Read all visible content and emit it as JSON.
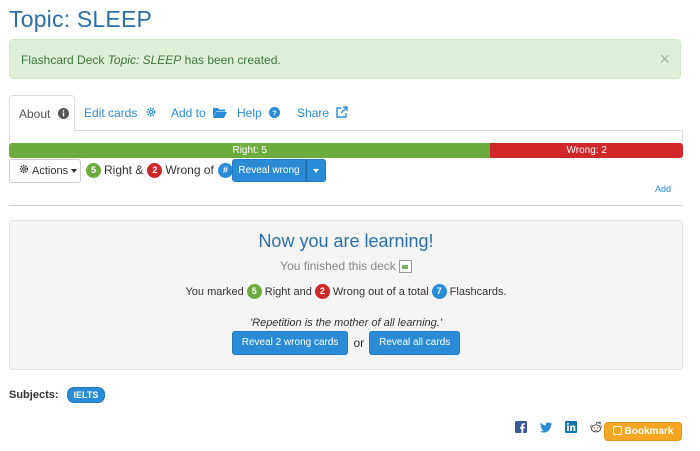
{
  "page": {
    "title": "Topic: SLEEP"
  },
  "alert": {
    "prefix": "Flashcard Deck ",
    "deck_name": "Topic: SLEEP",
    "suffix": " has been created.",
    "close_glyph": "×"
  },
  "tabs": [
    {
      "label": "About",
      "icon": "info-circle-icon"
    },
    {
      "label": "Edit cards",
      "icon": "cog-icon"
    },
    {
      "label": "Add to",
      "icon": "folder-open-icon"
    },
    {
      "label": "Help",
      "icon": "question-circle-icon"
    },
    {
      "label": "Share",
      "icon": "external-link-icon"
    }
  ],
  "progress": {
    "right_label": "Right: 5",
    "wrong_label": "Wrong: 2",
    "right_fraction": 0.7143,
    "colors": {
      "right": "#6cac3c",
      "wrong": "#d0272a"
    }
  },
  "toolbar": {
    "actions_label": "Actions",
    "right_count": "5",
    "right_text": "Right &",
    "wrong_count": "2",
    "wrong_text": "Wrong of",
    "total_placeholder": "#",
    "reveal_wrong_label": "Reveal wrong",
    "add_link": "Add"
  },
  "learning": {
    "heading": "Now you are learning!",
    "finished": "You finished this deck",
    "marked_prefix": "You marked",
    "right_count": "5",
    "right_and": "Right and",
    "wrong_count": "2",
    "wrong_out_of": "Wrong out of a total",
    "total_count": "7",
    "flashcards": "Flashcards.",
    "quote": "'Repetition is the mother of all learning.'",
    "reveal_wrong_cards": "Reveal 2 wrong cards",
    "or": "or",
    "reveal_all_cards": "Reveal all cards"
  },
  "subjects": {
    "label": "Subjects:",
    "tags": [
      "IELTS"
    ]
  },
  "social": {
    "icons": [
      "facebook-icon",
      "twitter-icon",
      "linkedin-icon",
      "reddit-icon"
    ],
    "bookmark_label": "Bookmark"
  },
  "colors": {
    "primary": "#2a8bd6",
    "title": "#2a6fa8",
    "success_bg": "#dff0d8",
    "bookmark": "#f5a623"
  }
}
